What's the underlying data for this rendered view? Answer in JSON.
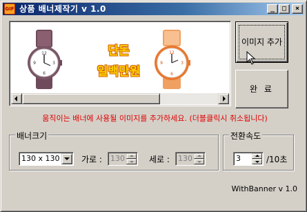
{
  "window": {
    "title": "상품 배너제작기 v 1.0",
    "icon_text": "GIF",
    "controls": {
      "minimize": "_",
      "maximize": "□",
      "close": "×"
    }
  },
  "preview": {
    "banner_text_line1": "단돈",
    "banner_text_line2": "일백만원",
    "images": [
      "watch-icon",
      "watch-icon"
    ]
  },
  "buttons": {
    "add_image": "이미지 추가",
    "done": "완 료"
  },
  "hint": "움직이는 배너에 사용될 이미지를 추가하세요. (더블클릭시 취소됩니다)",
  "banner_size": {
    "group_label": "배너크기",
    "selected": "130 x 130",
    "width_label": "가로 :",
    "width_value": "130",
    "height_label": "세로 :",
    "height_value": "130"
  },
  "transition_speed": {
    "group_label": "전환속도",
    "value": "3",
    "unit": "/10초"
  },
  "version": "WithBanner v 1.0",
  "colors": {
    "hint_text": "#e00000",
    "banner_text": "#ffd200",
    "banner_outline": "#d06000",
    "titlebar_start": "#0a246a"
  }
}
